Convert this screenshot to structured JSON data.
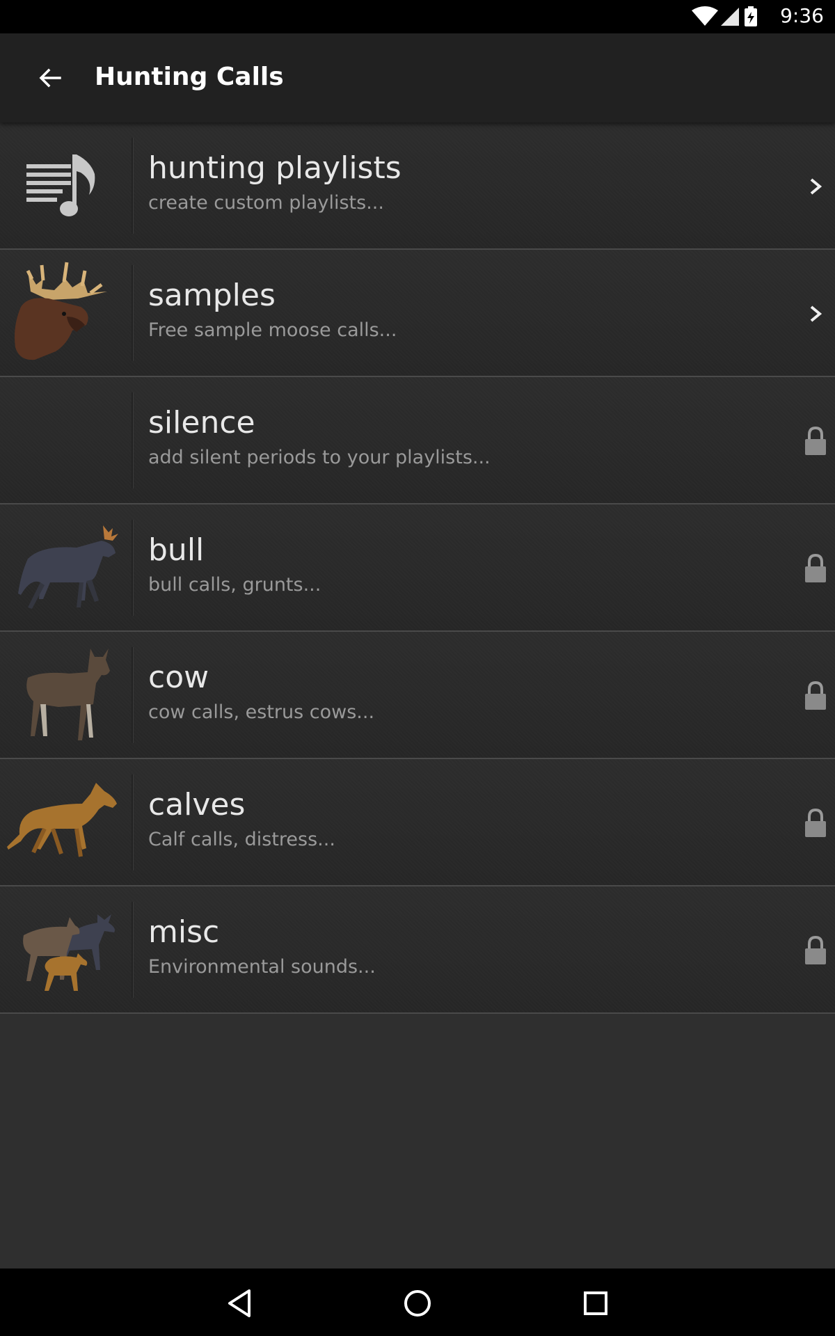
{
  "status_bar": {
    "time": "9:36",
    "icons": [
      "wifi-icon",
      "cell-signal-icon",
      "battery-charging-icon"
    ]
  },
  "app_bar": {
    "back_icon": "arrow-back-icon",
    "title": "Hunting Calls"
  },
  "list": {
    "items": [
      {
        "title": "hunting playlists",
        "subtitle": "create custom playlists...",
        "thumb": "playlist-icon",
        "trailing": "chevron-right-icon",
        "locked": false
      },
      {
        "title": "samples",
        "subtitle": "Free sample moose calls...",
        "thumb": "moose-head-image",
        "trailing": "chevron-right-icon",
        "locked": false
      },
      {
        "title": "silence",
        "subtitle": "add silent periods to your playlists...",
        "thumb": "",
        "trailing": "lock-icon",
        "locked": true
      },
      {
        "title": "bull",
        "subtitle": "bull calls, grunts...",
        "thumb": "bull-moose-image",
        "trailing": "lock-icon",
        "locked": true
      },
      {
        "title": "cow",
        "subtitle": "cow calls, estrus cows...",
        "thumb": "cow-moose-image",
        "trailing": "lock-icon",
        "locked": true
      },
      {
        "title": "calves",
        "subtitle": "Calf calls, distress...",
        "thumb": "calf-moose-image",
        "trailing": "lock-icon",
        "locked": true
      },
      {
        "title": "misc",
        "subtitle": "Environmental sounds...",
        "thumb": "moose-family-image",
        "trailing": "lock-icon",
        "locked": true
      }
    ]
  },
  "nav_bar": {
    "buttons": [
      "back-triangle-icon",
      "home-circle-icon",
      "recents-square-icon"
    ]
  },
  "colors": {
    "background": "#2f2f2f",
    "app_bar": "#212121",
    "title_text": "#e8e8e8",
    "subtitle_text": "#9a9a9a",
    "divider": "#4a4a4a"
  }
}
